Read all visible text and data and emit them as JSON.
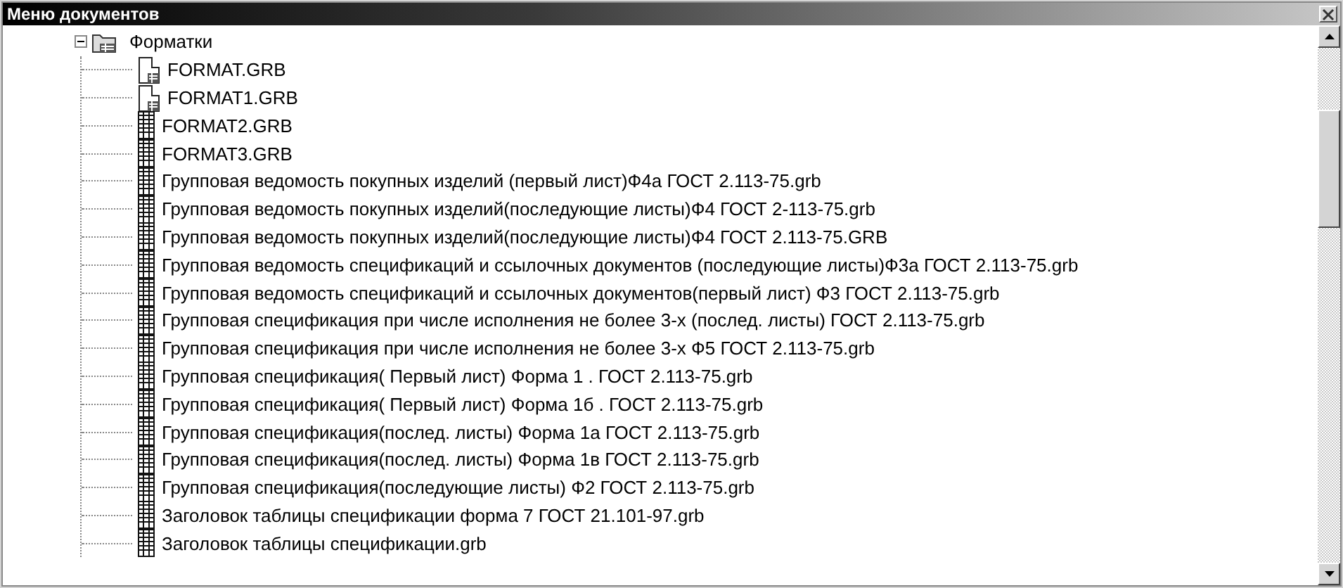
{
  "window": {
    "title": "Меню документов"
  },
  "tree": [
    {
      "label": "Форматки",
      "expanded": true,
      "children": [
        {
          "label": "FORMAT.GRB",
          "kind": "form"
        },
        {
          "label": "FORMAT1.GRB",
          "kind": "form"
        },
        {
          "label": "FORMAT2.GRB",
          "kind": "table"
        },
        {
          "label": "FORMAT3.GRB",
          "kind": "table"
        },
        {
          "label": "Групповая ведомость покупных изделий (первый лист)Ф4а ГОСТ 2.113-75.grb",
          "kind": "table"
        },
        {
          "label": "Групповая ведомость покупных изделий(последующие листы)Ф4 ГОСТ 2-113-75.grb",
          "kind": "table"
        },
        {
          "label": "Групповая ведомость покупных изделий(последующие листы)Ф4 ГОСТ 2.113-75.GRB",
          "kind": "table"
        },
        {
          "label": "Групповая ведомость спецификаций и ссылочных документов (последующие листы)Ф3а ГОСТ 2.113-75.grb",
          "kind": "table"
        },
        {
          "label": "Групповая ведомость спецификаций и ссылочных документов(первый лист) Ф3 ГОСТ 2.113-75.grb",
          "kind": "table"
        },
        {
          "label": "Групповая спецификация при числе исполнения не более 3-х (послед. листы) ГОСТ 2.113-75.grb",
          "kind": "table"
        },
        {
          "label": "Групповая спецификация при числе исполнения не более 3-х Ф5 ГОСТ 2.113-75.grb",
          "kind": "table"
        },
        {
          "label": "Групповая спецификация( Первый лист) Форма 1 . ГОСТ 2.113-75.grb",
          "kind": "table"
        },
        {
          "label": "Групповая спецификация( Первый лист) Форма 1б . ГОСТ 2.113-75.grb",
          "kind": "table"
        },
        {
          "label": "Групповая спецификация(послед. листы)  Форма 1а ГОСТ 2.113-75.grb",
          "kind": "table"
        },
        {
          "label": "Групповая спецификация(послед. листы)  Форма 1в ГОСТ 2.113-75.grb",
          "kind": "table"
        },
        {
          "label": "Групповая спецификация(последующие листы)  Ф2 ГОСТ 2.113-75.grb",
          "kind": "table"
        },
        {
          "label": "Заголовок таблицы спецификации форма 7 ГОСТ 21.101-97.grb",
          "kind": "table"
        },
        {
          "label": "Заголовок таблицы спецификации.grb",
          "kind": "table"
        }
      ]
    }
  ]
}
